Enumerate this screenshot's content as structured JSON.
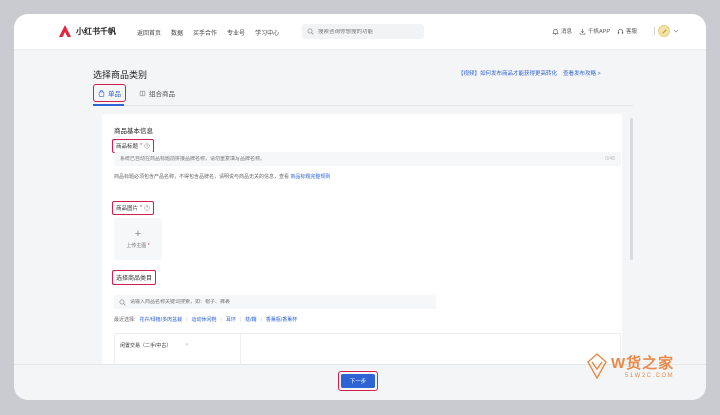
{
  "app": {
    "name": "小红书千帆"
  },
  "nav": {
    "items": [
      "返回首页",
      "数据",
      "买手合作",
      "专业号",
      "学习中心"
    ]
  },
  "search": {
    "placeholder": "搜索咨询你想搜的功能"
  },
  "tools": {
    "message": "消息",
    "app": "千帆APP",
    "service": "客服"
  },
  "page": {
    "title": "选择商品类别",
    "links": [
      "【视频】如何发布商品才能获得更高转化",
      "查看发布攻略 >"
    ]
  },
  "tabs": [
    {
      "label": "单品",
      "active": true
    },
    {
      "label": "组合商品",
      "active": false
    }
  ],
  "form": {
    "section_title": "商品基本信息",
    "title_field": {
      "label": "商品标题",
      "placeholder": "系统已自动在商品标题前拼接品牌名称，请勿重复填写品牌名称。",
      "counter": "0/48"
    },
    "hint": {
      "text": "商品标题必须包含产品名称，不得包含品牌名，请明说与商品无关的信息，查看",
      "link": "商品标题完整规则"
    },
    "image_field": {
      "label": "商品图片",
      "upload_plus": "+",
      "upload_label": "上传主图"
    },
    "category_field": {
      "label": "选择商品类目",
      "placeholder": "请输入商品名称关键词搜索，如：帽子、裤裹"
    },
    "recent": {
      "label": "最近选择:",
      "items": [
        "花卉/绿植/多肉盆栽",
        "运动休闲鞋",
        "耳环",
        "枕/鞘",
        "香薰瓶/香薰杯"
      ]
    },
    "category_list": {
      "first_item": "闲置交易（二手/中古）",
      "arrow": ">"
    }
  },
  "footer": {
    "next_label": "下一步"
  },
  "watermark": {
    "main": "W货之家",
    "sub": "51W2C.COM"
  },
  "colors": {
    "accent": "#2e63d6",
    "highlight_border": "#d1204c",
    "brand_red": "#e4243c"
  }
}
